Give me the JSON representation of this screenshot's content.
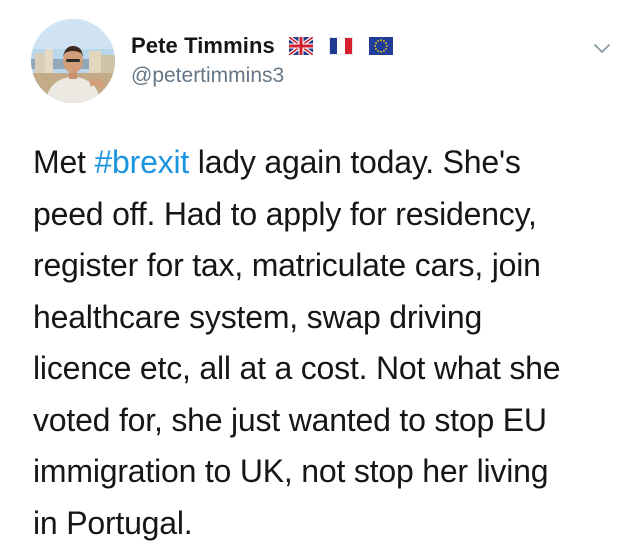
{
  "author": {
    "display_name": "Pete Timmins",
    "handle": "@petertimmins3",
    "name_flags": [
      "uk-flag-icon",
      "france-flag-icon",
      "eu-flag-icon"
    ]
  },
  "menu": {
    "icon": "chevron-down-icon"
  },
  "tweet": {
    "lines": [
      {
        "before": "Met ",
        "hashtag": "#brexit",
        "after": " lady again today. She's"
      },
      {
        "text": "peed off. Had to apply for residency,"
      },
      {
        "text": "register for tax, matriculate cars, join"
      },
      {
        "text": "healthcare system, swap driving"
      },
      {
        "text": "licence etc, all at a cost. Not what she"
      },
      {
        "text": "voted for, she just wanted to stop EU"
      },
      {
        "text": "immigration to UK, not stop her living"
      },
      {
        "text": "in Portugal."
      }
    ]
  },
  "colors": {
    "text": "#14171a",
    "secondary": "#657786",
    "link": "#1b95e0"
  }
}
